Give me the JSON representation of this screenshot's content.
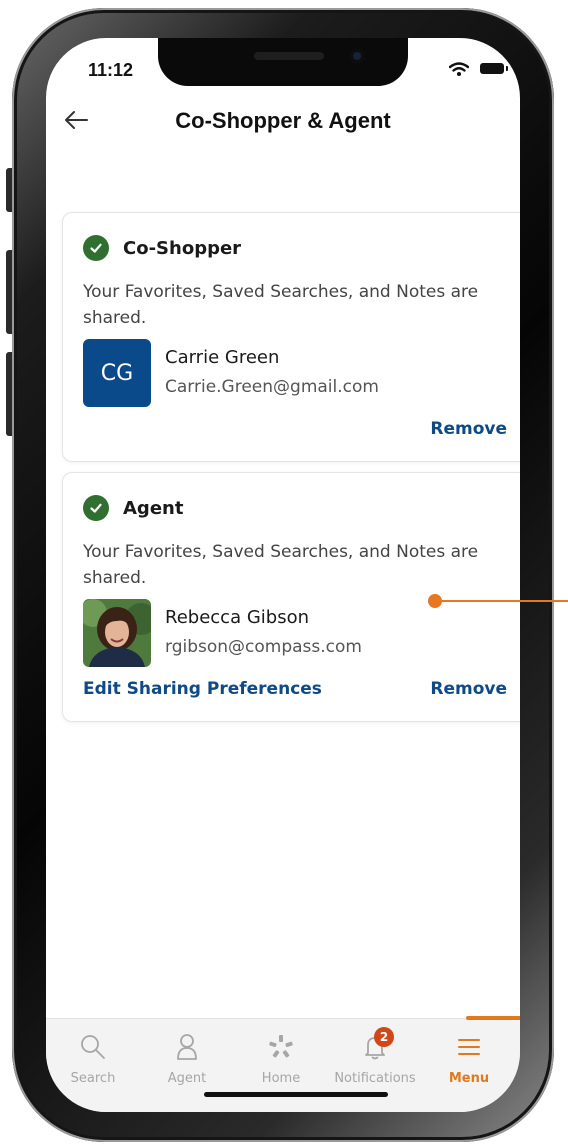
{
  "status_bar": {
    "time": "11:12"
  },
  "header": {
    "title": "Co-Shopper & Agent"
  },
  "co_shopper": {
    "title": "Co-Shopper",
    "description": "Your Favorites, Saved Searches, and Notes are shared.",
    "initials": "CG",
    "name": "Carrie Green",
    "email": "Carrie.Green@gmail.com",
    "remove_label": "Remove"
  },
  "agent": {
    "title": "Agent",
    "description": "Your Favorites, Saved Searches, and Notes are shared.",
    "name": "Rebecca Gibson",
    "email": "rgibson@compass.com",
    "edit_label": "Edit Sharing Preferences",
    "remove_label": "Remove"
  },
  "tabs": [
    {
      "label": "Search",
      "icon": "search-icon",
      "active": false
    },
    {
      "label": "Agent",
      "icon": "person-icon",
      "active": false
    },
    {
      "label": "Home",
      "icon": "home-logo-icon",
      "active": false
    },
    {
      "label": "Notifications",
      "icon": "bell-icon",
      "active": false,
      "badge": "2"
    },
    {
      "label": "Menu",
      "icon": "menu-icon",
      "active": true
    }
  ],
  "colors": {
    "brand_blue": "#0e4a86",
    "check_green": "#2f6f2f",
    "accent_orange": "#e07a1e",
    "badge_red": "#d0481a"
  }
}
